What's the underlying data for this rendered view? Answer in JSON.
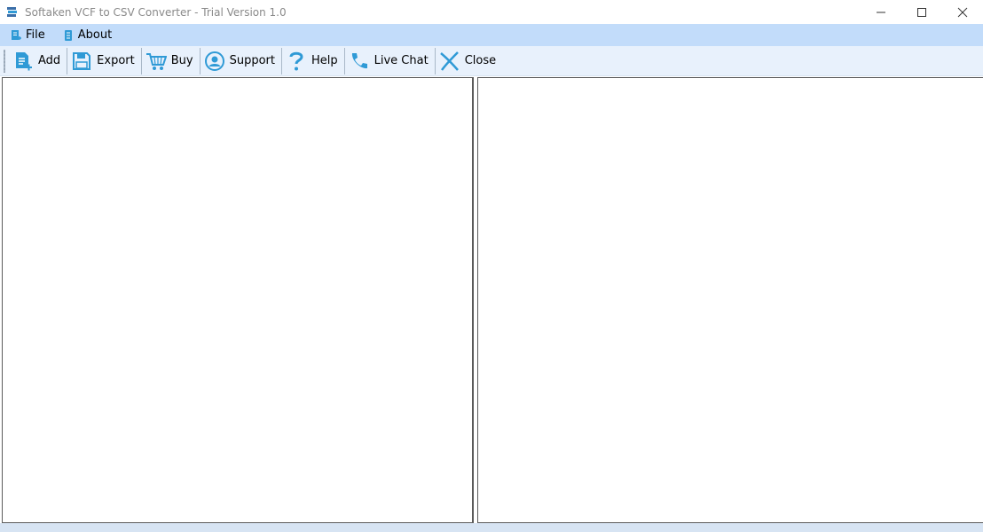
{
  "window": {
    "title": "Softaken VCF to CSV Converter - Trial Version 1.0"
  },
  "menu": {
    "items": [
      {
        "label": "File",
        "icon": "document-icon"
      },
      {
        "label": "About",
        "icon": "info-book-icon"
      }
    ]
  },
  "toolbar": {
    "add_label": "Add",
    "export_label": "Export",
    "buy_label": "Buy",
    "support_label": "Support",
    "help_label": "Help",
    "livechat_label": "Live Chat",
    "close_label": "Close"
  },
  "colors": {
    "accent": "#2f9ad6",
    "menubar_bg": "#c2dcfa",
    "toolbar_bg": "#e8f1fc"
  }
}
